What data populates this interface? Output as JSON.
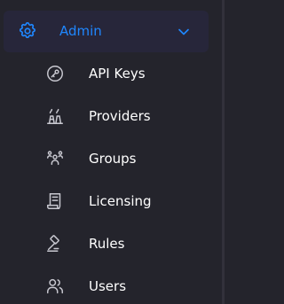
{
  "colors": {
    "background": "#24242c",
    "header_background": "#27263a",
    "accent": "#1f87ff",
    "item_text": "#ffffff",
    "icon_stroke": "#c9c9d1"
  },
  "section": {
    "title": "Admin",
    "icon": "gear-icon",
    "expanded": true,
    "chevron": "chevron-down-icon"
  },
  "items": [
    {
      "label": "API Keys",
      "icon": "key-icon"
    },
    {
      "label": "Providers",
      "icon": "providers-icon"
    },
    {
      "label": "Groups",
      "icon": "groups-icon"
    },
    {
      "label": "Licensing",
      "icon": "license-icon"
    },
    {
      "label": "Rules",
      "icon": "gavel-icon"
    },
    {
      "label": "Users",
      "icon": "users-icon"
    }
  ]
}
